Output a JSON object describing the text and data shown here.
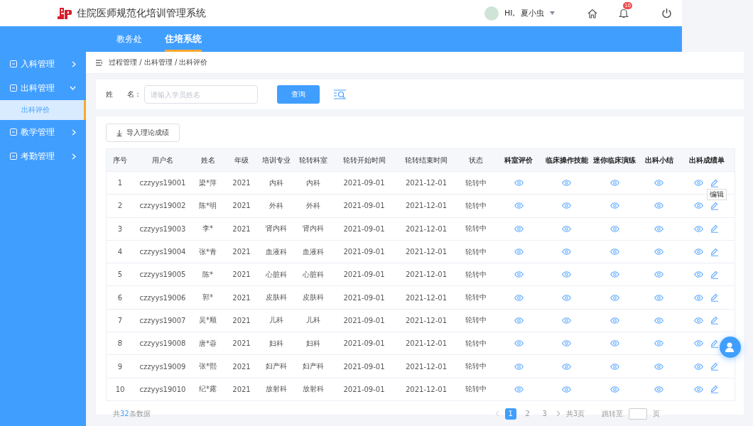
{
  "header": {
    "title": "住院医师规范化培训管理系统",
    "greeting": "HI,",
    "user": "夏小虫",
    "badge": "10"
  },
  "nav_tabs": [
    {
      "label": "教务处",
      "selected": false
    },
    {
      "label": "住培系统",
      "selected": true
    }
  ],
  "sidebar": {
    "items": [
      {
        "label": "入科管理",
        "expanded": false
      },
      {
        "label": "出科管理",
        "expanded": true,
        "children": [
          {
            "label": "出科评价",
            "selected": true
          }
        ]
      },
      {
        "label": "教学管理",
        "expanded": false
      },
      {
        "label": "考勤管理",
        "expanded": false
      }
    ]
  },
  "breadcrumb": "过程管理 / 出科管理 / 出科评价",
  "search": {
    "label": "姓　　名：",
    "placeholder": "请输入学员姓名",
    "button": "查询"
  },
  "import_button": "导入理论成绩",
  "table": {
    "columns": [
      "序号",
      "用户名",
      "姓名",
      "年级",
      "培训专业",
      "轮转科室",
      "轮转开始时间",
      "轮转结束时间",
      "状态",
      "科室评价",
      "临床操作技能",
      "迷你临床演练",
      "出科小结",
      "出科成绩单"
    ],
    "rows": [
      {
        "no": "1",
        "user": "czzyys19001",
        "name": "梁*萍",
        "grade": "2021",
        "major": "内科",
        "dept": "内科",
        "start": "2021-09-01",
        "end": "2021-12-01",
        "status": "轮转中",
        "tooltip": "编辑"
      },
      {
        "no": "2",
        "user": "czzyys19002",
        "name": "陈*明",
        "grade": "2021",
        "major": "外科",
        "dept": "外科",
        "start": "2021-09-01",
        "end": "2021-12-01",
        "status": "轮转中"
      },
      {
        "no": "3",
        "user": "czzyys19003",
        "name": "李*",
        "grade": "2021",
        "major": "肾内科",
        "dept": "肾内科",
        "start": "2021-09-01",
        "end": "2021-12-01",
        "status": "轮转中"
      },
      {
        "no": "4",
        "user": "czzyys19004",
        "name": "张*青",
        "grade": "2021",
        "major": "血液科",
        "dept": "血液科",
        "start": "2021-09-01",
        "end": "2021-12-01",
        "status": "轮转中"
      },
      {
        "no": "5",
        "user": "czzyys19005",
        "name": "陈*",
        "grade": "2021",
        "major": "心脏科",
        "dept": "心脏科",
        "start": "2021-09-01",
        "end": "2021-12-01",
        "status": "轮转中"
      },
      {
        "no": "6",
        "user": "czzyys19006",
        "name": "郭*",
        "grade": "2021",
        "major": "皮肤科",
        "dept": "皮肤科",
        "start": "2021-09-01",
        "end": "2021-12-01",
        "status": "轮转中"
      },
      {
        "no": "7",
        "user": "czzyys19007",
        "name": "吴*顺",
        "grade": "2021",
        "major": "儿科",
        "dept": "儿科",
        "start": "2021-09-01",
        "end": "2021-12-01",
        "status": "轮转中"
      },
      {
        "no": "8",
        "user": "czzyys19008",
        "name": "唐*蓉",
        "grade": "2021",
        "major": "妇科",
        "dept": "妇科",
        "start": "2021-09-01",
        "end": "2021-12-01",
        "status": "轮转中"
      },
      {
        "no": "9",
        "user": "czzyys19009",
        "name": "张*熙",
        "grade": "2021",
        "major": "妇产科",
        "dept": "妇产科",
        "start": "2021-09-01",
        "end": "2021-12-01",
        "status": "轮转中"
      },
      {
        "no": "10",
        "user": "czzyys19010",
        "name": "纪*露",
        "grade": "2021",
        "major": "放射科",
        "dept": "放射科",
        "start": "2021-09-01",
        "end": "2021-12-01",
        "status": "轮转中"
      }
    ]
  },
  "footer": {
    "total_prefix": "共",
    "total_count": "32",
    "total_suffix": "条数据"
  },
  "pagination": {
    "pages": [
      {
        "label": "1",
        "selected": true
      },
      {
        "label": "2",
        "selected": false
      },
      {
        "label": "3",
        "selected": false
      }
    ],
    "page_count": "共3页",
    "jump_label": "跳转至",
    "jump_suffix": "页"
  }
}
